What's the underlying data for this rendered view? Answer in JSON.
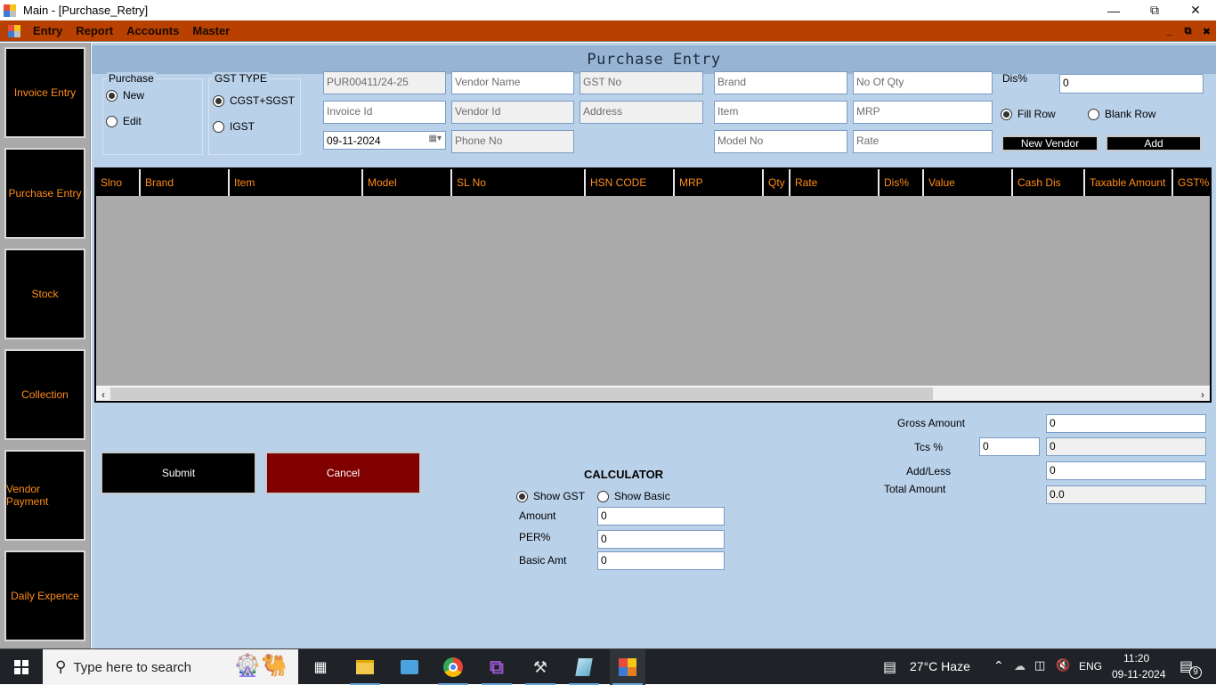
{
  "window": {
    "title": "Main - [Purchase_Retry]",
    "controls": [
      "minimize",
      "restore",
      "close"
    ]
  },
  "menubar": {
    "items": [
      "Entry",
      "Report",
      "Accounts",
      "Master"
    ]
  },
  "sidebar": {
    "items": [
      {
        "label": "Invoice Entry"
      },
      {
        "label": "Purchase Entry"
      },
      {
        "label": "Stock"
      },
      {
        "label": "Collection"
      },
      {
        "label": "Vendor Payment"
      },
      {
        "label": "Daily Expence"
      }
    ]
  },
  "form": {
    "title": "Purchase Entry",
    "purchase_group": {
      "label": "Purchase",
      "options": [
        {
          "label": "New",
          "checked": true
        },
        {
          "label": "Edit",
          "checked": false
        }
      ]
    },
    "gst_group": {
      "label": "GST TYPE",
      "options": [
        {
          "label": "CGST+SGST",
          "checked": true
        },
        {
          "label": "IGST",
          "checked": false
        }
      ]
    },
    "fields": {
      "purchase_no": {
        "value": "PUR00411/24-25"
      },
      "invoice_id": {
        "placeholder": "Invoice Id"
      },
      "date": {
        "value": "09-11-2024"
      },
      "vendor_name": {
        "placeholder": "Vendor Name"
      },
      "vendor_id": {
        "placeholder": "Vendor Id"
      },
      "phone_no": {
        "placeholder": "Phone No"
      },
      "gst_no": {
        "placeholder": "GST No"
      },
      "address": {
        "placeholder": "Address"
      },
      "brand": {
        "placeholder": "Brand"
      },
      "item": {
        "placeholder": "Item"
      },
      "model_no": {
        "placeholder": "Model No"
      },
      "no_of_qty": {
        "placeholder": "No Of Qty"
      },
      "mrp": {
        "placeholder": "MRP"
      },
      "rate": {
        "placeholder": "Rate"
      },
      "dis_label": "Dis%",
      "dis_value": "0"
    },
    "row_mode": {
      "options": [
        {
          "label": "Fill Row",
          "checked": true
        },
        {
          "label": "Blank Row",
          "checked": false
        }
      ]
    },
    "buttons": {
      "new_vendor": "New Vendor",
      "add": "Add",
      "submit": "Submit",
      "cancel": "Cancel"
    },
    "grid": {
      "columns": [
        "Slno",
        "Brand",
        "Item",
        "Model",
        "SL No",
        "HSN CODE",
        "MRP",
        "Qty",
        "Rate",
        "Dis%",
        "Value",
        "Cash Dis",
        "Taxable Amount",
        "GST%"
      ],
      "rows": []
    },
    "calculator": {
      "title": "CALCULATOR",
      "options": [
        {
          "label": "Show GST",
          "checked": true
        },
        {
          "label": "Show Basic",
          "checked": false
        }
      ],
      "amount_label": "Amount",
      "amount_value": "0",
      "per_label": "PER%",
      "per_value": "0",
      "basic_label": "Basic Amt",
      "basic_value": "0"
    },
    "totals": {
      "gross_label": "Gross Amount",
      "gross_value": "0",
      "tcs_label": "Tcs %",
      "tcs_percent": "0",
      "tcs_value": "0",
      "addless_label": "Add/Less",
      "addless_value": "0",
      "total_label": "Total Amount",
      "total_value": "0.0"
    }
  },
  "taskbar": {
    "search_placeholder": "Type here to search",
    "weather": "27°C  Haze",
    "language": "ENG",
    "time": "11:20",
    "date": "09-11-2024",
    "notification_count": "9"
  }
}
